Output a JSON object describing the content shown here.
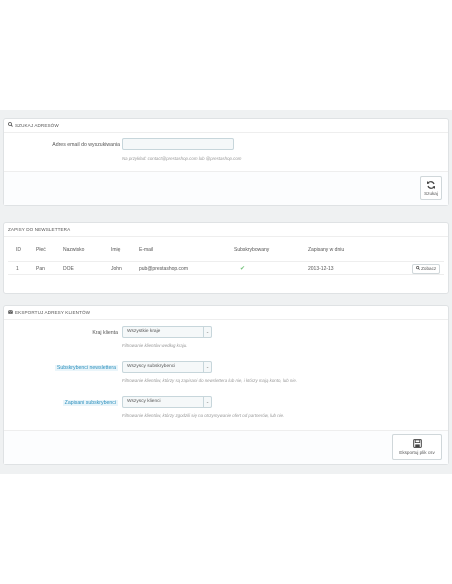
{
  "search_panel": {
    "title": "Szukaj adresów",
    "email_label": "Adres email do wyszukiwania",
    "email_value": "",
    "email_help": "Na przykład: contact@prestashop.com lub @prestashop.com",
    "search_button": "Szukaj"
  },
  "newsletter_panel": {
    "title": "Zapisy do newslettera",
    "columns": [
      "ID",
      "Płeć",
      "Nazwisko",
      "Imię",
      "E-mail",
      "Subskrybowany",
      "Zapisany w dniu"
    ],
    "rows": [
      {
        "id": "1",
        "gender": "Pan",
        "lastname": "DOE",
        "firstname": "John",
        "email": "pub@prestashop.com",
        "subscribed": "✔",
        "date": "2013-12-13",
        "action": "Zobacz"
      }
    ]
  },
  "export_panel": {
    "title": "Eksportuj adresy klientów",
    "country_label": "Kraj klienta",
    "country_value": "Wszystkie kraje",
    "country_help": "Filtrowanie klientów według kraju.",
    "subscribers_label": "Subskrybenci newslettera",
    "subscribers_value": "Wszyscy subskrybenci",
    "subscribers_help": "Filtrowanie klientów, którzy są zapisani do newslettera lub nie, i którzy mają konto, lub nie.",
    "optin_label": "Zapisani subskrybenci",
    "optin_value": "Wszyscy klienci",
    "optin_help": "Filtrowanie klientów, którzy zgodzili się na otrzymywanie ofert od partnerów, lub nie.",
    "export_button": "Eksportuj plik csv"
  },
  "colors": {
    "accent": "#2a8fbd",
    "check": "#72c279",
    "background": "#eff1f2"
  }
}
